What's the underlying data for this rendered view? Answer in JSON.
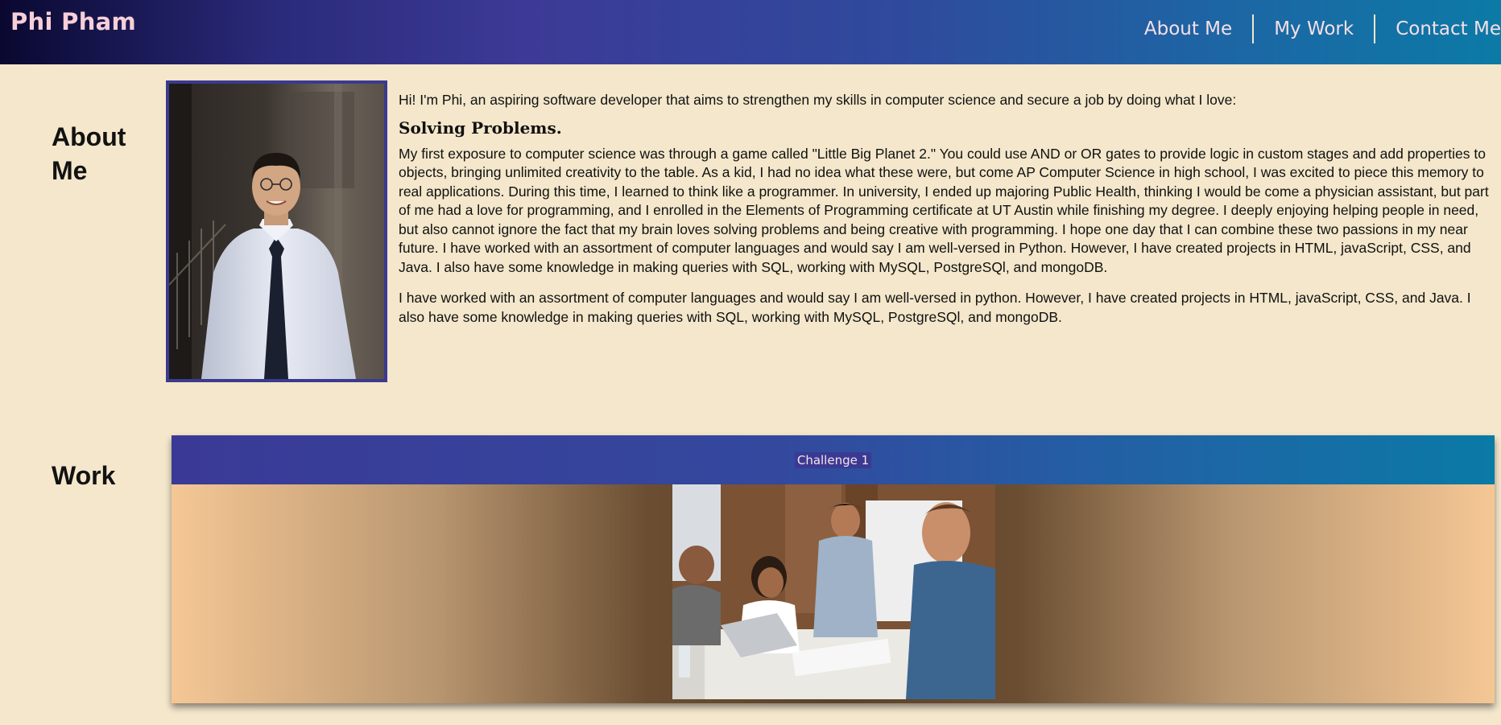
{
  "header": {
    "brand": "Phi Pham",
    "nav": [
      "About Me",
      "My Work",
      "Contact Me"
    ]
  },
  "about": {
    "title": "About Me",
    "photo_alt": "Portrait of Phi Pham",
    "intro": "Hi! I'm Phi, an aspiring software developer that aims to strengthen my skills in computer science and secure a job by doing what I love:",
    "subheading": "Solving Problems.",
    "paragraph1": "My first exposure to computer science was through a game called \"Little Big Planet 2.\" You could use AND or OR gates to provide logic in custom stages and add properties to objects, bringing unlimited creativity to the table. As a kid, I had no idea what these were, but come AP Computer Science in high school, I was excited to piece this memory to real applications. During this time, I learned to think like a programmer. In university, I ended up majoring Public Health, thinking I would be come a physician assistant, but part of me had a love for programming, and I enrolled in the Elements of Programming certificate at UT Austin while finishing my degree. I deeply enjoying helping people in need, but also cannot ignore the fact that my brain loves solving problems and being creative with programming. I hope one day that I can combine these two passions in my near future. I have worked with an assortment of computer languages and would say I am well-versed in Python. However, I have created projects in HTML, javaScript, CSS, and Java. I also have some knowledge in making queries with SQL, working with MySQL, PostgreSQl, and mongoDB.",
    "paragraph2": "I have worked with an assortment of computer languages and would say I am well-versed in python. However, I have created projects in HTML, javaScript, CSS, and Java. I also have some knowledge in making queries with SQL, working with MySQL, PostgreSQl, and mongoDB."
  },
  "work": {
    "title": "Work",
    "card_title": "Challenge 1"
  },
  "colors": {
    "background": "#f4e7cb",
    "header_start": "#0a0830",
    "header_end": "#0c7aa6",
    "accent": "#3b3a90",
    "brand_text": "#f6cfd8"
  }
}
